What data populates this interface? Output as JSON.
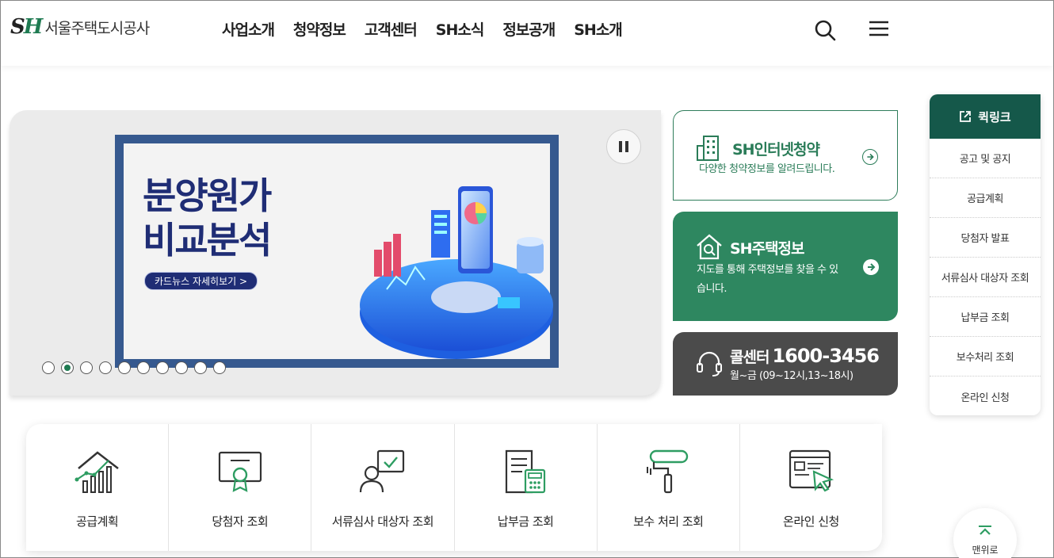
{
  "header": {
    "logo_mark": "SH",
    "logo_name": "서울주택도시공사",
    "nav": [
      "사업소개",
      "청약정보",
      "고객센터",
      "SH소식",
      "정보공개",
      "SH소개"
    ],
    "search_icon": "search-icon",
    "menu_icon": "hamburger-icon"
  },
  "banner": {
    "title_line1": "분양원가",
    "title_line2": "비교분석",
    "button_label": "카드뉴스 자세히보기 >",
    "slide_count": 10,
    "active_slide": 2,
    "accent": "#36598f",
    "title_color": "#1f2d75"
  },
  "cards": {
    "subscription": {
      "title": "SH인터넷청약",
      "desc": "다양한 청약정보를 알려드립니다."
    },
    "housing": {
      "title": "SH주택정보",
      "desc": "지도를 통해 주택정보를 찾을 수 있습니다."
    },
    "callcenter": {
      "title": "콜센터",
      "phone": "1600-3456",
      "hours": "월~금 (09~12시,13~18시)"
    }
  },
  "quicklink": {
    "title": "퀵링크",
    "items": [
      "공고 및 공지",
      "공급계획",
      "당첨자 발표",
      "서류심사 대상자 조회",
      "납부금 조회",
      "보수처리 조회",
      "온라인 신청"
    ]
  },
  "services": [
    {
      "label": "공급계획",
      "icon": "house-chart-icon"
    },
    {
      "label": "당첨자 조회",
      "icon": "certificate-icon"
    },
    {
      "label": "서류심사 대상자 조회",
      "icon": "person-check-icon"
    },
    {
      "label": "납부금 조회",
      "icon": "calculator-doc-icon"
    },
    {
      "label": "보수 처리 조회",
      "icon": "paint-roller-icon"
    },
    {
      "label": "온라인 신청",
      "icon": "browser-cursor-icon"
    }
  ],
  "top_button": "맨위로",
  "colors": {
    "brand_green": "#1f7b52",
    "dark_green": "#15584a",
    "card_green": "#2e8760",
    "card_gray": "#4b4b4b"
  }
}
